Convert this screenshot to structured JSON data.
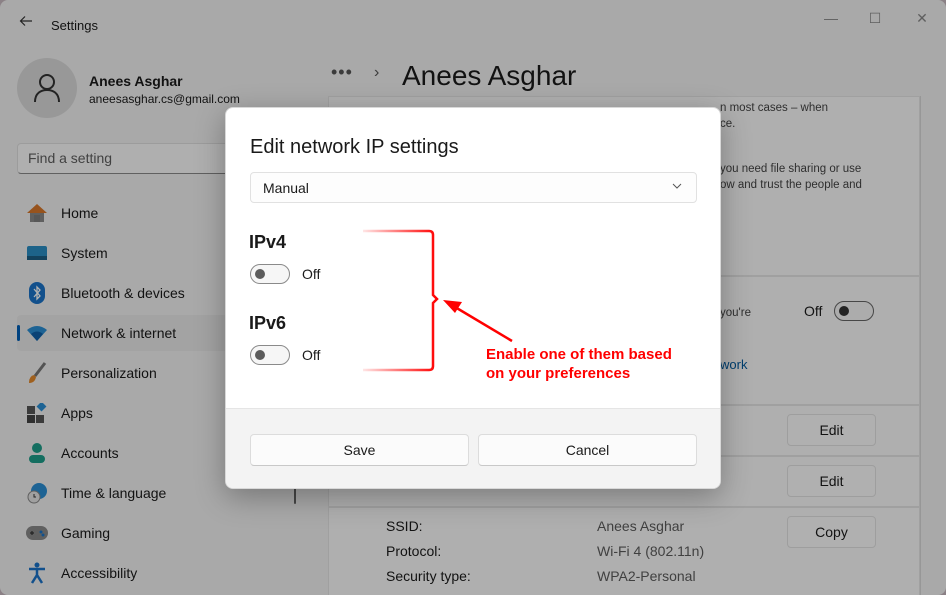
{
  "window": {
    "app_title": "Settings",
    "controls": {
      "minimize": "—",
      "maximize": "☐",
      "close": "✕"
    }
  },
  "profile": {
    "name": "Anees Asghar",
    "email": "aneesasghar.cs@gmail.com"
  },
  "search": {
    "placeholder": "Find a setting"
  },
  "sidebar": {
    "items": [
      {
        "label": "Home",
        "icon": "home-icon",
        "active": false
      },
      {
        "label": "System",
        "icon": "system-icon",
        "active": false
      },
      {
        "label": "Bluetooth & devices",
        "icon": "bluetooth-icon",
        "active": false
      },
      {
        "label": "Network & internet",
        "icon": "wifi-icon",
        "active": true
      },
      {
        "label": "Personalization",
        "icon": "brush-icon",
        "active": false
      },
      {
        "label": "Apps",
        "icon": "apps-icon",
        "active": false
      },
      {
        "label": "Accounts",
        "icon": "accounts-icon",
        "active": false
      },
      {
        "label": "Time & language",
        "icon": "time-language-icon",
        "active": false
      },
      {
        "label": "Gaming",
        "icon": "gaming-icon",
        "active": false
      },
      {
        "label": "Accessibility",
        "icon": "accessibility-icon",
        "active": false
      }
    ]
  },
  "breadcrumb": {
    "overflow": "•••",
    "separator": "›",
    "title": "Anees Asghar"
  },
  "background": {
    "text_line_1": "n most cases – when",
    "text_line_2": "ce.",
    "text_line_3": "you need file sharing or use",
    "text_line_4": "ow and trust the people and",
    "metered_text": "you're",
    "metered_toggle_label": "Off",
    "link_partial": "work",
    "edit_button_1": "Edit",
    "edit_button_2": "Edit",
    "copy_button": "Copy",
    "properties": [
      {
        "key": "SSID:",
        "value": "Anees Asghar"
      },
      {
        "key": "Protocol:",
        "value": "Wi-Fi 4 (802.11n)"
      },
      {
        "key": "Security type:",
        "value": "WPA2-Personal"
      }
    ]
  },
  "dialog": {
    "title": "Edit network IP settings",
    "mode_select": {
      "value": "Manual",
      "chevron": "⌄"
    },
    "ipv4": {
      "label": "IPv4",
      "state": "Off",
      "enabled": false
    },
    "ipv6": {
      "label": "IPv6",
      "state": "Off",
      "enabled": false
    },
    "save_label": "Save",
    "cancel_label": "Cancel"
  },
  "annotation": {
    "line_1": "Enable one of them based",
    "line_2": "on your preferences",
    "color": "#ff0000"
  },
  "colors": {
    "accent": "#005fb8",
    "annotation": "#ff0000"
  }
}
